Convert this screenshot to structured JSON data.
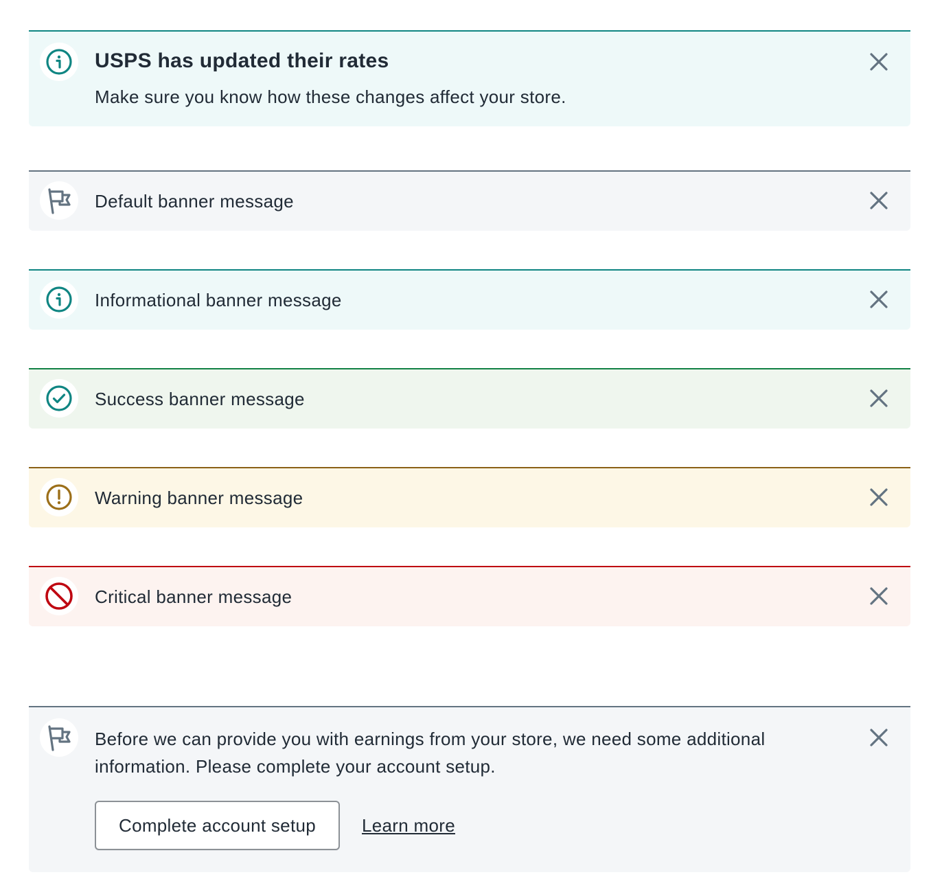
{
  "colors": {
    "default_icon": "#637381",
    "info_icon": "#0f8582",
    "success_icon": "#0f8582",
    "warning_icon": "#9c6f19",
    "critical_icon": "#bf0711",
    "close_icon": "#637381",
    "text": "#212b36"
  },
  "banners": {
    "usps": {
      "icon": "info-circle-icon",
      "title": "USPS has updated their rates",
      "body": "Make sure you know how these changes affect your store."
    },
    "default": {
      "icon": "flag-icon",
      "message": "Default banner message"
    },
    "info": {
      "icon": "info-circle-icon",
      "message": "Informational banner message"
    },
    "success": {
      "icon": "check-circle-icon",
      "message": "Success banner message"
    },
    "warning": {
      "icon": "exclamation-circle-icon",
      "message": "Warning banner message"
    },
    "critical": {
      "icon": "prohibited-icon",
      "message": "Critical banner message"
    },
    "setup": {
      "icon": "flag-icon",
      "message": "Before we can provide you with earnings from your store, we need some additional information. Please complete your account setup.",
      "primary_action": "Complete account setup",
      "secondary_action": "Learn more"
    }
  }
}
